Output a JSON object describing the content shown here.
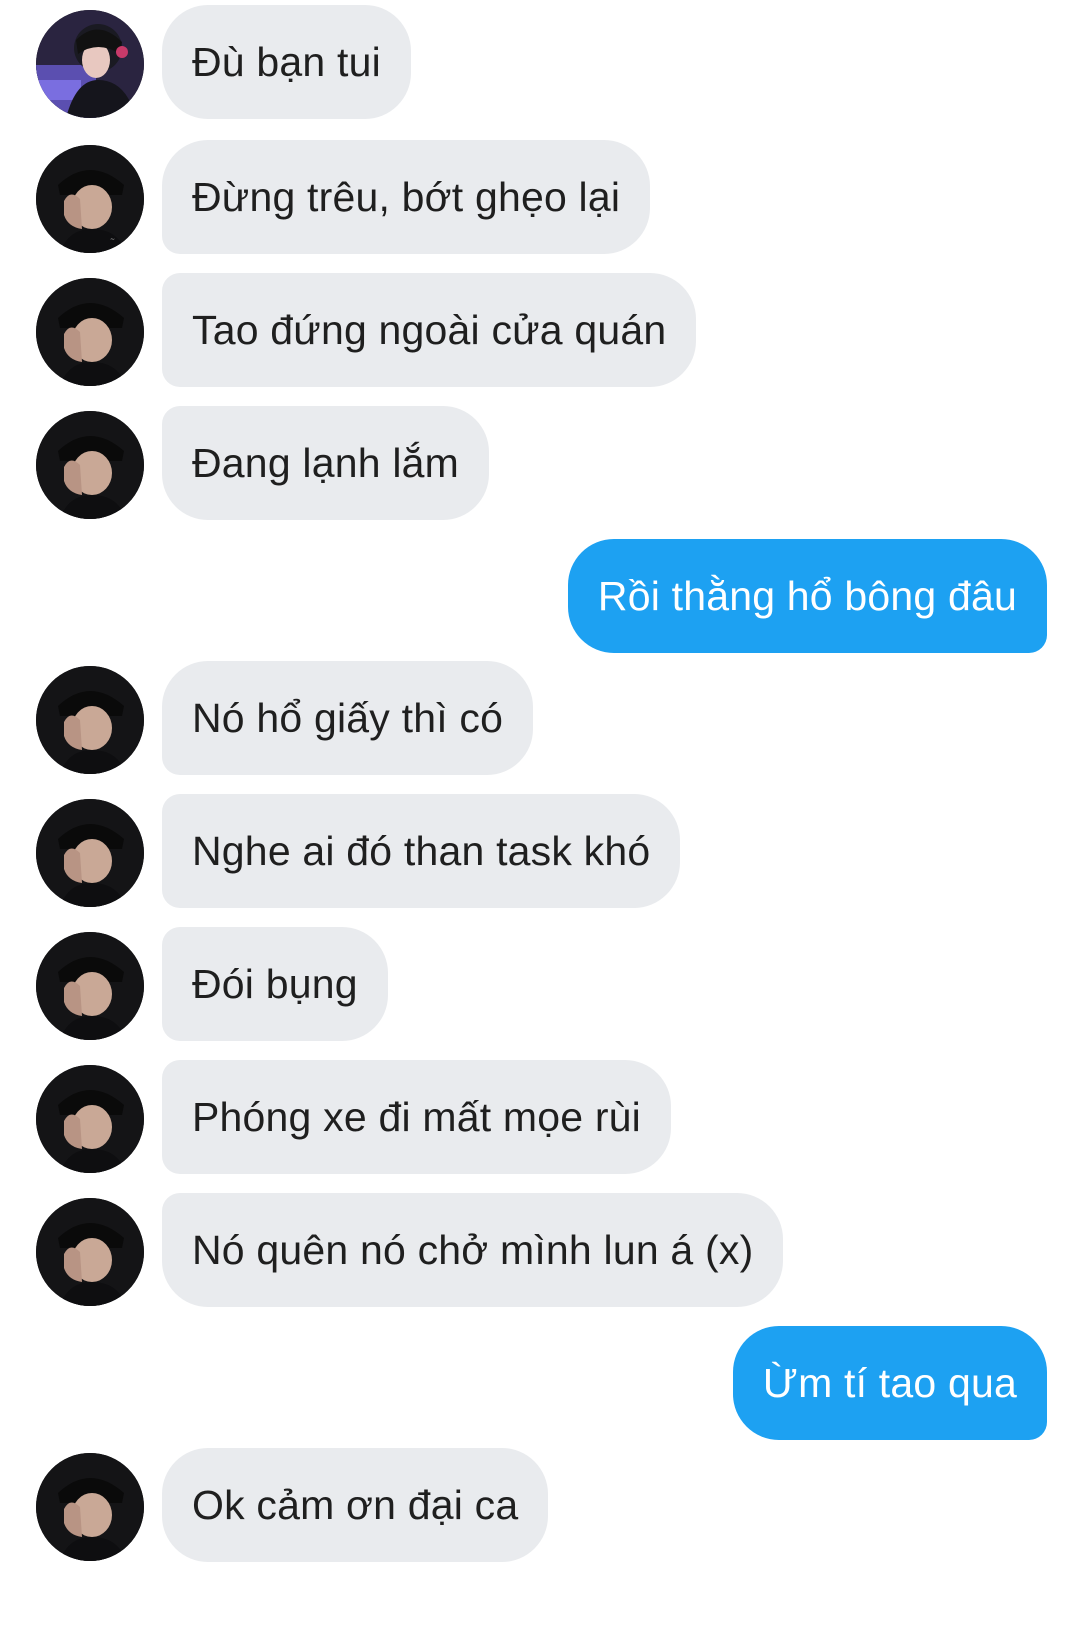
{
  "colors": {
    "incoming_bubble": "#e9ebee",
    "incoming_text": "#1f1f1f",
    "outgoing_bubble": "#1da1f2",
    "outgoing_text": "#ffffff"
  },
  "messages": [
    {
      "direction": "in",
      "avatar": "profile-photo-purple",
      "text": "Đù bạn tui"
    },
    {
      "direction": "in",
      "avatar": "profile-photo-dark",
      "text": "Đừng trêu, bớt ghẹo lại"
    },
    {
      "direction": "in",
      "avatar": "profile-photo-dark",
      "text": "Tao đứng ngoài cửa quán"
    },
    {
      "direction": "in",
      "avatar": "profile-photo-dark",
      "text": "Đang lạnh lắm"
    },
    {
      "direction": "out",
      "text": "Rồi thằng hổ bông đâu"
    },
    {
      "direction": "in",
      "avatar": "profile-photo-dark",
      "text": "Nó hổ giấy thì có"
    },
    {
      "direction": "in",
      "avatar": "profile-photo-dark",
      "text": "Nghe ai đó than task khó"
    },
    {
      "direction": "in",
      "avatar": "profile-photo-dark",
      "text": "Đói bụng"
    },
    {
      "direction": "in",
      "avatar": "profile-photo-dark",
      "text": "Phóng xe đi mất mọe rùi"
    },
    {
      "direction": "in",
      "avatar": "profile-photo-dark",
      "text": "Nó quên nó chở mình lun á (x)"
    },
    {
      "direction": "out",
      "text": "Ừm tí tao qua"
    },
    {
      "direction": "in",
      "avatar": "profile-photo-dark",
      "text": "Ok cảm ơn đại ca"
    }
  ]
}
